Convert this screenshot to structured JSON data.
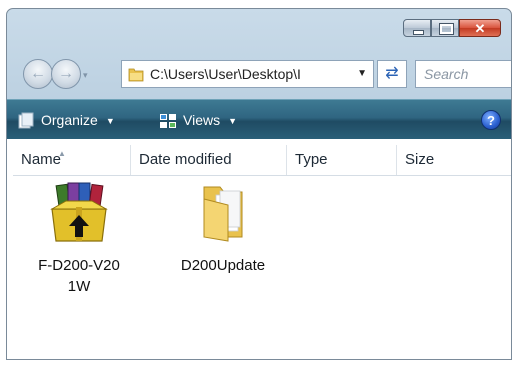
{
  "window": {
    "caption_buttons": [
      "minimize",
      "maximize",
      "close"
    ]
  },
  "nav": {
    "address_path": "C:\\Users\\User\\Desktop\\I",
    "search_placeholder": "Search",
    "back_arrow": "←",
    "forward_arrow": "→",
    "history_dropdown": "▾",
    "address_dropdown": "▼",
    "refresh_glyph": "⇄"
  },
  "toolbar": {
    "organize_label": "Organize",
    "views_label": "Views",
    "dropdown_arrow": "▼",
    "help_glyph": "?"
  },
  "columns": {
    "name": "Name",
    "date_modified": "Date modified",
    "type": "Type",
    "size": "Size",
    "sort_glyph": "▲"
  },
  "files": [
    {
      "name": "F-D200-V20\n1W",
      "line1": "F-D200-V20",
      "line2": "1W",
      "icon": "winrar-archive-icon"
    },
    {
      "name": "D200Update",
      "line1": "D200Update",
      "line2": "",
      "icon": "folder-icon"
    }
  ],
  "colors": {
    "toolbar": "#2f6581",
    "window_frame": "#b5cbdd",
    "close_button": "#d8533c",
    "folder": "#f2d36b"
  }
}
